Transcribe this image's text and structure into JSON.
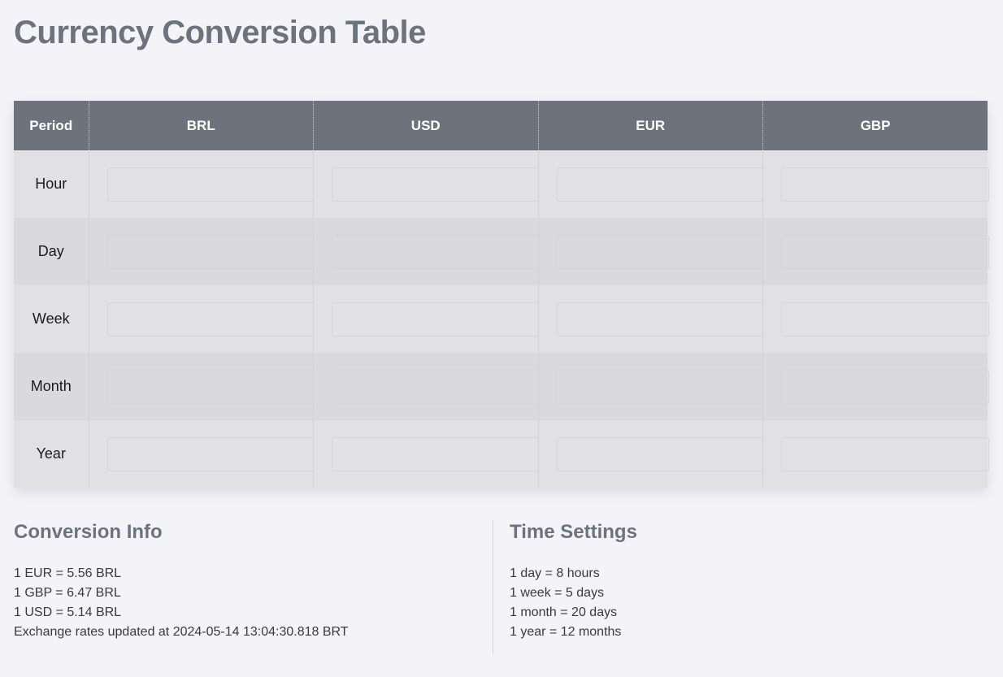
{
  "page": {
    "title": "Currency Conversion Table"
  },
  "table": {
    "headers": [
      "Period",
      "BRL",
      "USD",
      "EUR",
      "GBP"
    ],
    "rows": [
      {
        "period": "Hour",
        "values": [
          "",
          "",
          "",
          ""
        ]
      },
      {
        "period": "Day",
        "values": [
          "",
          "",
          "",
          ""
        ]
      },
      {
        "period": "Week",
        "values": [
          "",
          "",
          "",
          ""
        ]
      },
      {
        "period": "Month",
        "values": [
          "",
          "",
          "",
          ""
        ]
      },
      {
        "period": "Year",
        "values": [
          "",
          "",
          "",
          ""
        ]
      }
    ]
  },
  "conversion_info": {
    "title": "Conversion Info",
    "lines": [
      "1 EUR = 5.56 BRL",
      "1 GBP = 6.47 BRL",
      "1 USD = 5.14 BRL",
      "Exchange rates updated at 2024-05-14 13:04:30.818 BRT"
    ]
  },
  "time_settings": {
    "title": "Time Settings",
    "lines": [
      "1 day = 8 hours",
      "1 week = 5 days",
      "1 month = 20 days",
      "1 year = 12 months"
    ]
  },
  "colors": {
    "background": "#f4f3f8",
    "header_bg": "#6c737d",
    "title": "#6c737d",
    "row_odd": "#e1e1e3",
    "row_even": "#dadadc"
  }
}
